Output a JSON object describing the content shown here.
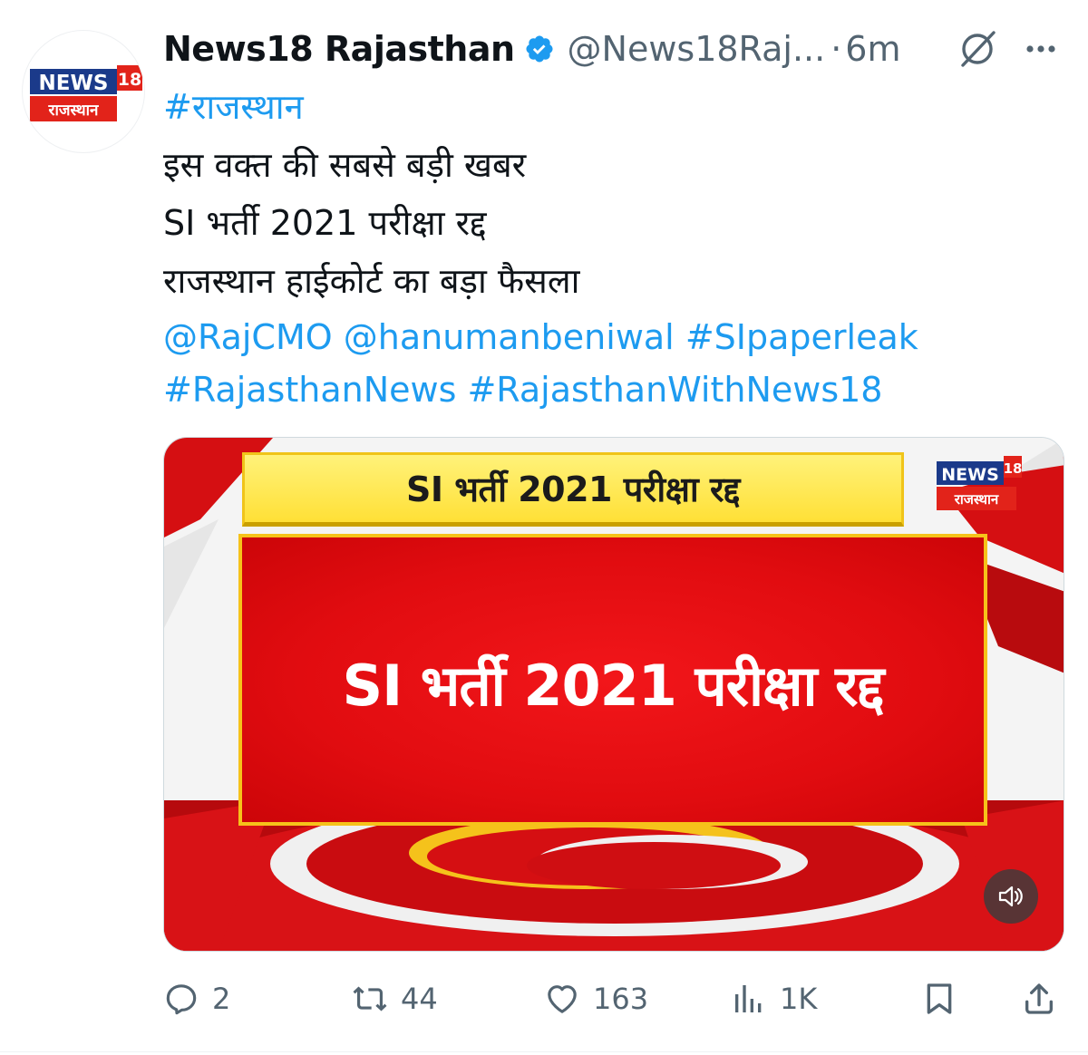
{
  "author": {
    "display_name": "News18 Rajasthan",
    "handle": "@News18Raj...",
    "separator": "·",
    "time": "6m",
    "verified": true,
    "avatar_logo": {
      "top": "NEWS",
      "number": "18",
      "bottom": "राजस्थान"
    }
  },
  "icons": {
    "grok": "grok-icon",
    "more": "more-icon",
    "verified": "verified-badge-icon"
  },
  "tweet": {
    "hashtag_top": "#राजस्थान",
    "line1": "इस वक्त की सबसे बड़ी खबर",
    "line2": "SI भर्ती 2021 परीक्षा रद्द",
    "line3": "राजस्थान हाईकोर्ट का बड़ा फैसला",
    "mention1": "@RajCMO",
    "mention2": "@hanumanbeniwal",
    "hashtag1": "#SIpaperleak",
    "hashtag2": "#RajasthanNews",
    "hashtag3": "#RajasthanWithNews18"
  },
  "media": {
    "strip_text": "SI भर्ती 2021 परीक्षा रद्द",
    "panel_text": "SI भर्ती 2021 परीक्षा रद्द",
    "logo": {
      "top": "NEWS",
      "number": "18",
      "bottom": "राजस्थान"
    },
    "mute_icon": "speaker-muted-icon"
  },
  "actions": {
    "replies": "2",
    "reposts": "44",
    "likes": "163",
    "views": "1K"
  },
  "colors": {
    "link": "#1d9bf0",
    "muted": "#536471",
    "text": "#0f1419",
    "verified": "#1d9bf0",
    "news_red": "#e10c10",
    "news_yellow": "#ffe036"
  }
}
